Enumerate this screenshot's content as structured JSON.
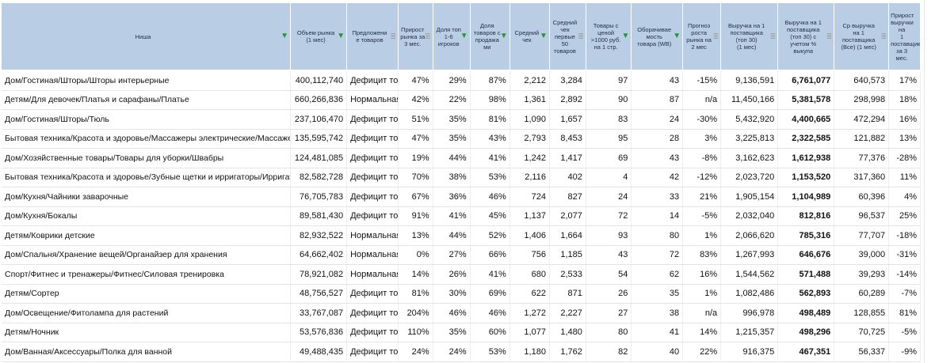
{
  "headers": [
    {
      "label": "Ниша",
      "filter": "active"
    },
    {
      "label": "Объем рынка\n(1 мес)",
      "filter": "active"
    },
    {
      "label": "Предложени\nе товаров",
      "filter": "inactive"
    },
    {
      "label": "Прирост\nрынка за\n3 мес.",
      "filter": "inactive"
    },
    {
      "label": "Доля топ\n1-6\nигроков",
      "filter": "active"
    },
    {
      "label": "Доля\nтоваров с\nпродажа\nми",
      "filter": "active"
    },
    {
      "label": "Средний\nчек",
      "filter": "active"
    },
    {
      "label": "Средний\nчек\nпервые\n50\nтоваров",
      "filter": "inactive"
    },
    {
      "label": "Товары с\nценой\n>1000 руб.\nна 1 стр.",
      "filter": "active"
    },
    {
      "label": "Оборачивае\nмость\nтовара (WB)",
      "filter": "active"
    },
    {
      "label": "Прогноз\nроста\nрынка на\n2 мес",
      "filter": "inactive"
    },
    {
      "label": "Выручка на 1\nпоставщика\n(топ 30)\n(1 мес)",
      "filter": "inactive"
    },
    {
      "label": "Выручка на 1\nпоставщика\n(топ 30) с\nучетом %\nвыкупа",
      "filter": "inactive"
    },
    {
      "label": "Ср выручка\nна 1\nпоставщика\n(Все) (1 мес)",
      "filter": "inactive"
    },
    {
      "label": "Прирост\nвыручки на\n1\nпоставщик\nза 3 мес.",
      "filter": "none"
    }
  ],
  "rows": [
    [
      "Дом/Гостиная/Шторы/Шторы интерьерные",
      "400,112,740",
      "Дефицит товара",
      "47%",
      "29%",
      "87%",
      "2,212",
      "3,284",
      "97",
      "43",
      "-15%",
      "9,136,591",
      "6,761,077",
      "640,573",
      "17%"
    ],
    [
      "Детям/Для девочек/Платья и сарафаны/Платье",
      "660,266,836",
      "Нормальная конкуренция",
      "42%",
      "22%",
      "98%",
      "1,361",
      "2,892",
      "90",
      "87",
      "n/a",
      "11,450,166",
      "5,381,578",
      "298,998",
      "18%"
    ],
    [
      "Дом/Гостиная/Шторы/Тюль",
      "237,106,470",
      "Дефицит товара",
      "51%",
      "35%",
      "81%",
      "1,090",
      "1,657",
      "83",
      "24",
      "-30%",
      "5,432,920",
      "4,400,665",
      "472,294",
      "16%"
    ],
    [
      "Бытовая техника/Красота и здоровье/Массажеры электрические/Массажер электрический",
      "135,595,742",
      "Дефицит товара",
      "47%",
      "35%",
      "43%",
      "2,793",
      "8,453",
      "95",
      "28",
      "3%",
      "3,225,813",
      "2,322,585",
      "121,882",
      "13%"
    ],
    [
      "Дом/Хозяйственные товары/Товары для уборки/Швабры",
      "124,481,085",
      "Дефицит товара",
      "19%",
      "44%",
      "41%",
      "1,242",
      "1,417",
      "69",
      "43",
      "-8%",
      "3,162,623",
      "1,612,938",
      "77,376",
      "-28%"
    ],
    [
      "Бытовая техника/Красота и здоровье/Зубные щетки и ирригаторы/Ирригатор",
      "82,582,728",
      "Дефицит товара",
      "70%",
      "38%",
      "53%",
      "2,116",
      "402",
      "4",
      "42",
      "-12%",
      "2,023,720",
      "1,153,520",
      "317,360",
      "11%"
    ],
    [
      "Дом/Кухня/Чайники заварочные",
      "76,705,783",
      "Дефицит товара",
      "67%",
      "36%",
      "46%",
      "724",
      "827",
      "24",
      "33",
      "21%",
      "1,905,154",
      "1,104,989",
      "60,396",
      "4%"
    ],
    [
      "Дом/Кухня/Бокалы",
      "89,581,430",
      "Дефицит товара",
      "91%",
      "41%",
      "45%",
      "1,137",
      "2,077",
      "72",
      "14",
      "-5%",
      "2,032,040",
      "812,816",
      "96,537",
      "25%"
    ],
    [
      "Детям/Коврики детские",
      "82,932,522",
      "Нормальная конкуренция",
      "13%",
      "44%",
      "52%",
      "1,406",
      "1,664",
      "93",
      "80",
      "1%",
      "2,066,620",
      "785,316",
      "77,707",
      "-18%"
    ],
    [
      "Дом/Спальня/Хранение вещей/Органайзер для хранения",
      "64,662,402",
      "Нормальная конкуренция",
      "0%",
      "27%",
      "66%",
      "756",
      "1,185",
      "43",
      "72",
      "83%",
      "1,267,993",
      "646,676",
      "39,000",
      "-31%"
    ],
    [
      "Спорт/Фитнес и тренажеры/Фитнес/Силовая тренировка",
      "78,921,082",
      "Нормальная конкуренция",
      "14%",
      "26%",
      "41%",
      "680",
      "2,533",
      "54",
      "62",
      "16%",
      "1,544,562",
      "571,488",
      "39,293",
      "-14%"
    ],
    [
      "Детям/Сортер",
      "48,756,527",
      "Дефицит товара",
      "81%",
      "30%",
      "69%",
      "622",
      "871",
      "26",
      "35",
      "1%",
      "1,082,486",
      "562,893",
      "60,289",
      "-7%"
    ],
    [
      "Дом/Освещение/Фитолампа для растений",
      "33,767,087",
      "Дефицит товара",
      "204%",
      "46%",
      "46%",
      "1,272",
      "2,227",
      "27",
      "38",
      "n/a",
      "996,978",
      "498,489",
      "128,855",
      "81%"
    ],
    [
      "Детям/Ночник",
      "53,576,836",
      "Дефицит товара",
      "110%",
      "35%",
      "60%",
      "1,077",
      "1,480",
      "80",
      "41",
      "14%",
      "1,215,357",
      "498,296",
      "70,725",
      "-5%"
    ],
    [
      "Дом/Ванная/Аксессуары/Полка для ванной",
      "49,488,435",
      "Дефицит товара",
      "24%",
      "24%",
      "53%",
      "1,180",
      "1,762",
      "82",
      "40",
      "22%",
      "916,375",
      "467,351",
      "56,337",
      "-9%"
    ]
  ],
  "colors": {
    "header_bg": "#b9cde5",
    "filter_active": "#2f8f3a",
    "filter_inactive": "#9aa3ad"
  },
  "icons": {
    "filter_active": "funnel-icon",
    "filter_inactive": "sort-filter-icon"
  }
}
